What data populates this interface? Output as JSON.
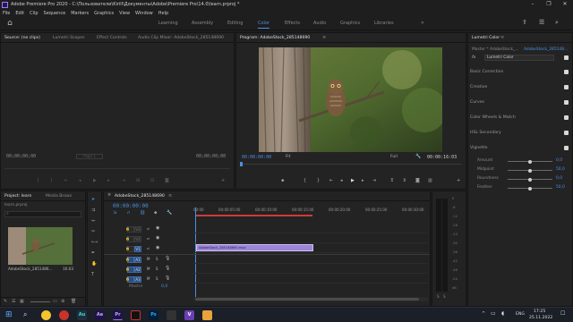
{
  "window": {
    "title": "Adobe Premiere Pro 2020 - C:\\Пользователи\\Kirill\\Документы\\Adobe\\Premiere Pro\\14.0\\learn.prproj *",
    "controls": [
      "–",
      "❐",
      "✕"
    ]
  },
  "menu": [
    "File",
    "Edit",
    "Clip",
    "Sequence",
    "Markers",
    "Graphics",
    "View",
    "Window",
    "Help"
  ],
  "workspaces": {
    "tabs": [
      "Learning",
      "Assembly",
      "Editing",
      "Color",
      "Effects",
      "Audio",
      "Graphics",
      "Libraries"
    ],
    "active": "Color"
  },
  "source_panel": {
    "tabs": [
      "Source: (no clips)",
      "Lumetri Scopes",
      "Effect Controls",
      "Audio Clip Mixer: AdobeStock_285148690"
    ],
    "timecode_left": "00;00;00;00",
    "page": "Page 1",
    "timecode_right": "00;00;00;00"
  },
  "program_panel": {
    "title": "Program: AdobeStock_285148690",
    "timecode_left": "00:00:00:00",
    "fit": "Fit",
    "quality": "Full",
    "timecode_right": "00:00:16:03"
  },
  "lumetri": {
    "title": "Lumetri Color",
    "master_left": "Master * AdobeStock_...",
    "master_right": "AdobeStock_285148...",
    "fx_label": "Lumetri Color",
    "sections": [
      "Basic Correction",
      "Creative",
      "Curves",
      "Color Wheels & Match",
      "HSL Secondary",
      "Vignette"
    ],
    "vignette": [
      {
        "label": "Amount",
        "value": "0,0",
        "pos": 0.5
      },
      {
        "label": "Midpoint",
        "value": "50,0",
        "pos": 0.5
      },
      {
        "label": "Roundness",
        "value": "0,0",
        "pos": 0.5
      },
      {
        "label": "Feather",
        "value": "50,0",
        "pos": 0.5
      }
    ]
  },
  "project_panel": {
    "tabs": [
      "Project: learn",
      "Media Brows"
    ],
    "file": "learn.prproj",
    "clip_name": "AdobeStock_2851486...",
    "clip_duration": "16:03"
  },
  "timeline": {
    "title": "AdobeStock_285148690",
    "timecode": "00:00:00:00",
    "ruler": [
      "00:00",
      "00:00:05:00",
      "00:00:10:00",
      "00:00:15:00",
      "00:00:20:00",
      "00:00:25:00",
      "00:00:30:00"
    ],
    "video_tracks": [
      "V3",
      "V2",
      "V1"
    ],
    "audio_tracks": [
      "A1",
      "A2",
      "A3"
    ],
    "mix_label": "Master",
    "mix_value": "0,0",
    "clip_label": "AdobeStock_285148690.mov"
  },
  "meters": {
    "scale": [
      "0",
      "-6",
      "-12",
      "-18",
      "-24",
      "-30",
      "-36",
      "-42",
      "-48",
      "-54",
      "dB"
    ],
    "channels": [
      "S",
      "S"
    ]
  },
  "taskbar": {
    "apps": [
      "Au",
      "Ae",
      "Pr",
      "Ps"
    ],
    "lang": "ENG",
    "time": "17:25",
    "date": "25.11.2022"
  },
  "colors": {
    "accent": "#4a90e2",
    "clip": "#9c86d8",
    "playhead_range": "#d23a3a"
  }
}
